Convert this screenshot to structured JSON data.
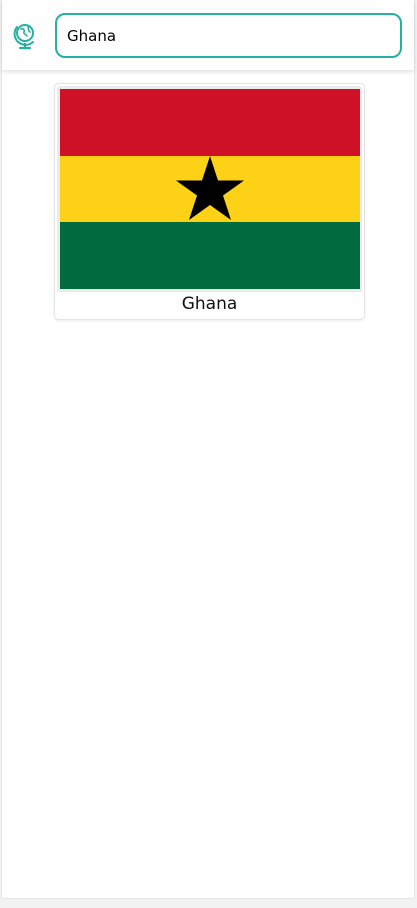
{
  "header": {
    "logo_icon": "globe-icon",
    "accent_color": "#26b0a0"
  },
  "search": {
    "value": "Ghana",
    "placeholder": ""
  },
  "results": [
    {
      "name": "Ghana",
      "flag_colors": [
        "#ce1126",
        "#fcd116",
        "#006b3f",
        "#000000"
      ]
    }
  ]
}
